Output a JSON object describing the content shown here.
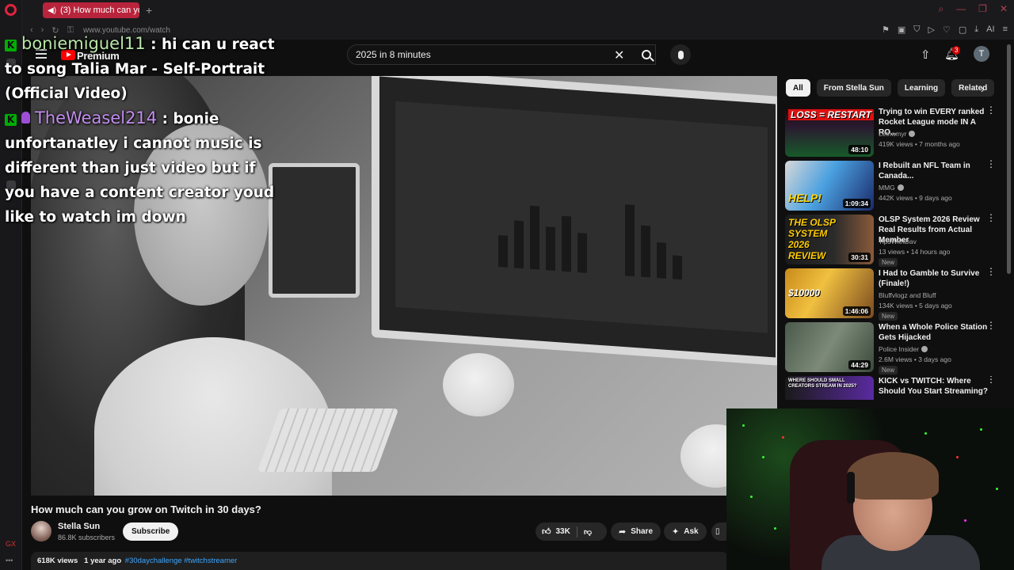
{
  "browser": {
    "tab_title": "(3) How much can you",
    "url": "www.youtube.com/watch"
  },
  "header": {
    "brand": "Premium",
    "search_query": "2025 in 8 minutes",
    "notification_count": "3",
    "avatar_letter": "T"
  },
  "chat": {
    "messages": [
      {
        "user": "boniemiguel11",
        "text": ": hi can u react to song Talia Mar - Self-Portrait (Official Video)"
      },
      {
        "user": "TheWeasel214",
        "text": ": bonie unfortanatley i cannot music is different than just video but if you have a content creator youd like to watch im down"
      }
    ]
  },
  "video": {
    "title": "How much can you grow on Twitch in 30 days?",
    "channel": "Stella Sun",
    "subscribers": "86.8K subscribers",
    "subscribe_label": "Subscribe",
    "likes": "33K",
    "share_label": "Share",
    "ask_label": "Ask",
    "views": "618K views",
    "age": "1 year ago",
    "tags": "#30daychallenge #twitchstreamer"
  },
  "chips": [
    "All",
    "From Stella Sun",
    "Learning",
    "Related"
  ],
  "recommendations": [
    {
      "title": "Trying to win EVERY ranked Rocket League mode IN A RO...",
      "channel": "Lethamyr",
      "meta": "419K views • 7 months ago",
      "duration": "48:10",
      "thumb_text": "LOSS = RESTART",
      "new": ""
    },
    {
      "title": "I Rebuilt an NFL Team in Canada...",
      "channel": "MMG",
      "meta": "442K views • 9 days ago",
      "duration": "1:09:34",
      "thumb_text": "HELP!",
      "new": ""
    },
    {
      "title": "OLSP System 2026 Review Real Results from Actual Member",
      "channel": "TipsWithDav",
      "meta": "13 views • 14 hours ago",
      "duration": "30:31",
      "thumb_text": "THE OLSP SYSTEM 2026 REVIEW",
      "new": "New"
    },
    {
      "title": "I Had to Gamble to Survive (Finale!)",
      "channel": "Bluffvlogz and Bluff",
      "meta": "134K views • 5 days ago",
      "duration": "1:46:06",
      "thumb_text": "$10000",
      "new": "New"
    },
    {
      "title": "When a Whole Police Station Gets Hijacked",
      "channel": "Police Insider",
      "meta": "2.6M views • 3 days ago",
      "duration": "44:29",
      "thumb_text": "",
      "new": "New"
    },
    {
      "title": "KICK vs TWITCH: Where Should You Start Streaming?",
      "channel": "",
      "meta": "",
      "duration": "",
      "thumb_text": "WHERE SHOULD SMALL CREATORS STREAM IN 2025?",
      "new": ""
    }
  ]
}
